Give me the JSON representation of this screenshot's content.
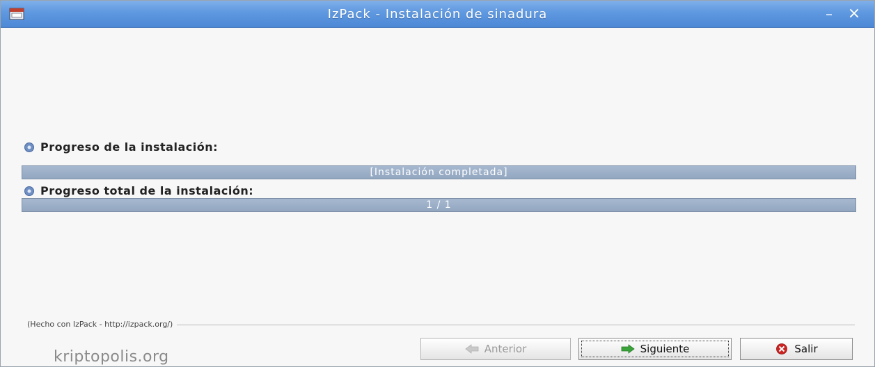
{
  "window": {
    "title": "IzPack - Instalación de sinadura",
    "minimize_glyph": "–",
    "close_glyph": "×"
  },
  "progress": {
    "pack": {
      "label": "Progreso de la instalación:",
      "bar_text": "[Instalación completada]",
      "fraction": 1.0
    },
    "overall": {
      "label": "Progreso total de la instalación:",
      "bar_text": "1 / 1",
      "fraction": 1.0
    }
  },
  "footer": {
    "made_with": "(Hecho con IzPack - http://izpack.org/)"
  },
  "buttons": {
    "previous": "Anterior",
    "next": "Siguiente",
    "exit": "Salir"
  },
  "watermark": "kriptopolis.org",
  "colors": {
    "titlebar": "#5e98e0",
    "progress_bar": "#9db0c8",
    "exit_icon": "#cc2222",
    "next_icon": "#3aa33a"
  }
}
